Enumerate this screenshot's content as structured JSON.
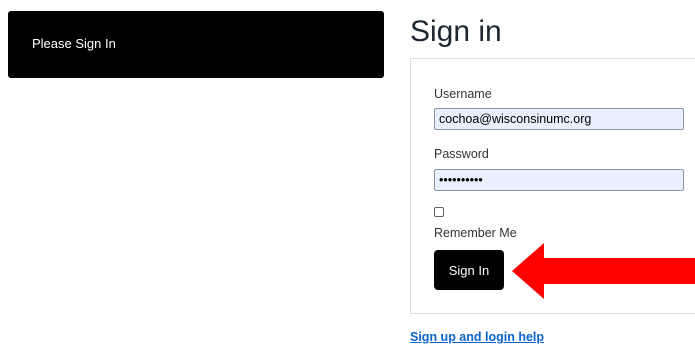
{
  "notice": {
    "text": "Please Sign In"
  },
  "form": {
    "title": "Sign in",
    "username_label": "Username",
    "username_value": "cochoa@wisconsinumc.org",
    "password_label": "Password",
    "password_value": "..........",
    "remember_label": "Remember Me",
    "remember_checked": false,
    "submit_label": "Sign In"
  },
  "help": {
    "link_text": "Sign up and login help"
  },
  "colors": {
    "notice_bg": "#000000",
    "button_bg": "#000000",
    "input_autofill_bg": "#e8f0fe",
    "annotation_arrow": "#ff0000",
    "link": "#0b63ce"
  },
  "annotation": {
    "icon": "arrow-left-icon"
  }
}
